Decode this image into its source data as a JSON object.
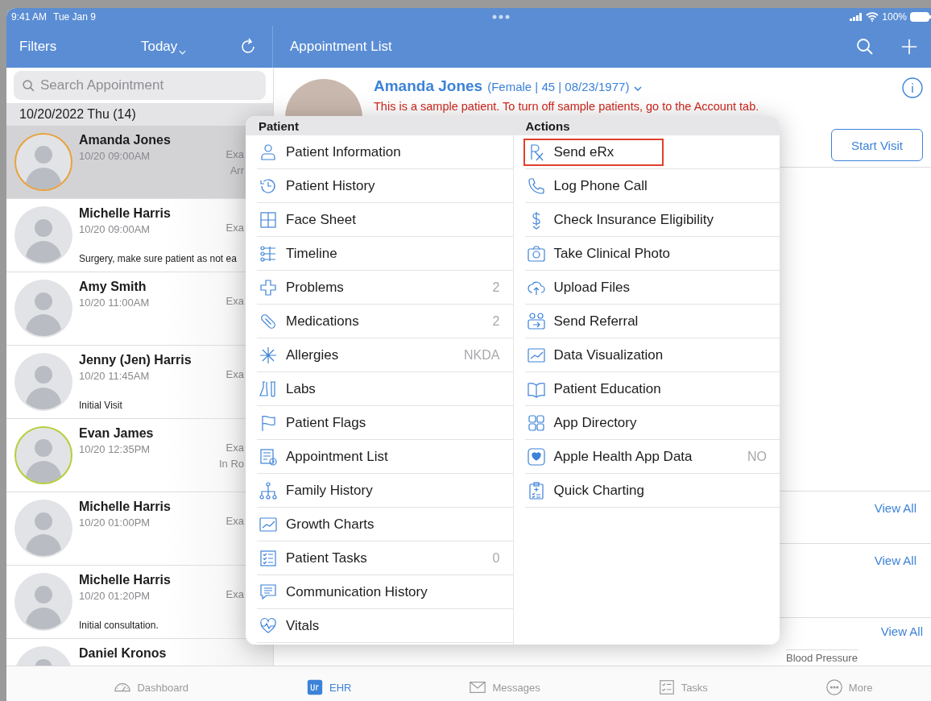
{
  "status_bar": {
    "time": "9:41 AM",
    "date": "Tue Jan 9",
    "battery": "100%"
  },
  "left_nav": {
    "filters": "Filters",
    "date_filter": "Today"
  },
  "search": {
    "placeholder": "Search Appointment"
  },
  "section_header": "10/20/2022 Thu (14)",
  "appointments": [
    {
      "name": "Amanda Jones",
      "time": "10/20 09:00AM",
      "type": "Exa",
      "status": "Arr",
      "color": "#e9a23b",
      "selected": true
    },
    {
      "name": "Michelle Harris",
      "time": "10/20 09:00AM",
      "type": "Exa",
      "note": "Surgery, make sure patient as not ea",
      "selected": false
    },
    {
      "name": "Amy Smith",
      "time": "10/20 11:00AM",
      "type": "Exa",
      "selected": false
    },
    {
      "name": "Jenny (Jen) Harris",
      "time": "10/20 11:45AM",
      "type": "Exa",
      "note": "Initial Visit",
      "selected": false
    },
    {
      "name": "Evan James",
      "time": "10/20 12:35PM",
      "type": "Exa",
      "status": "In Ro",
      "color": "#b5cf3a",
      "selected": false
    },
    {
      "name": "Michelle Harris",
      "time": "10/20 01:00PM",
      "type": "Exa",
      "selected": false
    },
    {
      "name": "Michelle Harris",
      "time": "10/20 01:20PM",
      "type": "Exa",
      "note": "Initial consultation.",
      "selected": false
    },
    {
      "name": "Daniel Kronos",
      "selected": false
    }
  ],
  "right_nav": {
    "title": "Appointment List"
  },
  "patient": {
    "name": "Amanda Jones",
    "details": "(Female | 45 | 08/23/1977)",
    "notice": "This is a sample patient. To turn off sample patients, go to the Account tab.",
    "start_visit": "Start Visit"
  },
  "sections": [
    {
      "link": "View All"
    },
    {
      "link": "View All"
    },
    {
      "link": "View All",
      "item": "Blood Pressure"
    }
  ],
  "menu": {
    "patient_title": "Patient",
    "actions_title": "Actions",
    "patient_items": [
      {
        "kind": "person",
        "label": "Patient Information"
      },
      {
        "kind": "history",
        "label": "Patient History"
      },
      {
        "kind": "grid",
        "label": "Face Sheet"
      },
      {
        "kind": "timeline",
        "label": "Timeline"
      },
      {
        "kind": "cross",
        "label": "Problems",
        "value": "2"
      },
      {
        "kind": "pill",
        "label": "Medications",
        "value": "2"
      },
      {
        "kind": "asterisk",
        "label": "Allergies",
        "value": "NKDA"
      },
      {
        "kind": "flask",
        "label": "Labs"
      },
      {
        "kind": "flag",
        "label": "Patient Flags"
      },
      {
        "kind": "listclock",
        "label": "Appointment List"
      },
      {
        "kind": "tree",
        "label": "Family History"
      },
      {
        "kind": "chart",
        "label": "Growth Charts"
      },
      {
        "kind": "checklist",
        "label": "Patient Tasks",
        "value": "0"
      },
      {
        "kind": "chat",
        "label": "Communication History"
      },
      {
        "kind": "heart",
        "label": "Vitals"
      }
    ],
    "action_items": [
      {
        "kind": "rx",
        "label": "Send eRx",
        "highlighted": true
      },
      {
        "kind": "phone",
        "label": "Log Phone Call",
        "highlighted": false
      },
      {
        "kind": "dollar",
        "label": "Check Insurance Eligibility",
        "highlighted": false
      },
      {
        "kind": "camera",
        "label": "Take Clinical Photo",
        "highlighted": false
      },
      {
        "kind": "cloud",
        "label": "Upload Files",
        "highlighted": false
      },
      {
        "kind": "referral",
        "label": "Send Referral",
        "highlighted": false
      },
      {
        "kind": "chart",
        "label": "Data Visualization",
        "highlighted": false
      },
      {
        "kind": "book",
        "label": "Patient Education",
        "highlighted": false
      },
      {
        "kind": "apps",
        "label": "App Directory",
        "highlighted": false
      },
      {
        "kind": "health",
        "label": "Apple Health App Data",
        "value": "NO",
        "highlighted": false
      },
      {
        "kind": "clipboard",
        "label": "Quick Charting",
        "highlighted": false
      }
    ]
  },
  "tab_bar": [
    {
      "kind": "gauge",
      "label": "Dashboard",
      "selected": false
    },
    {
      "kind": "ehr",
      "label": "EHR",
      "selected": true
    },
    {
      "kind": "mail",
      "label": "Messages",
      "selected": false
    },
    {
      "kind": "tasks",
      "label": "Tasks",
      "selected": false
    },
    {
      "kind": "more",
      "label": "More",
      "selected": false
    }
  ]
}
